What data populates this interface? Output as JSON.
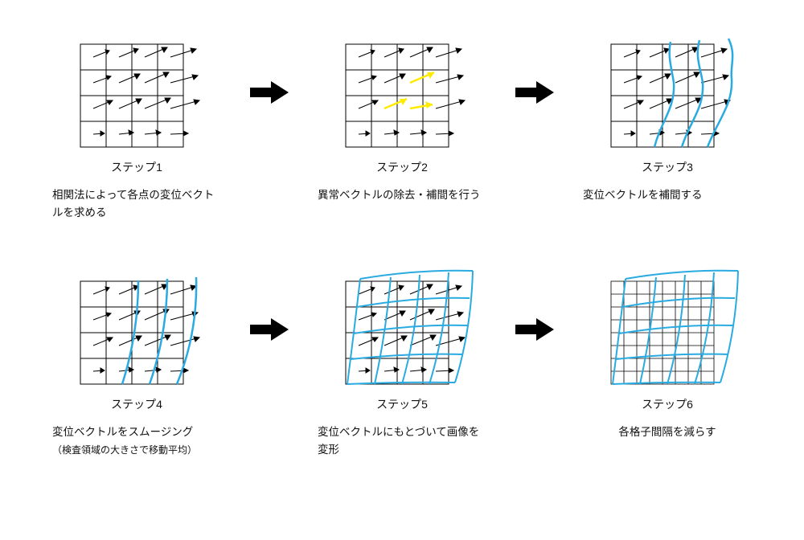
{
  "steps": [
    {
      "label": "ステップ1",
      "desc": "相関法によって各点の変位ベクトルを求める"
    },
    {
      "label": "ステップ2",
      "desc": "異常ベクトルの除去・補間を行う"
    },
    {
      "label": "ステップ3",
      "desc": "変位ベクトルを補間する"
    },
    {
      "label": "ステップ4",
      "desc": "変位ベクトルをスムージング",
      "desc_sub": "（検査領域の大きさで移動平均）"
    },
    {
      "label": "ステップ5",
      "desc": "変位ベクトルにもとづいて画像を変形"
    },
    {
      "label": "ステップ6",
      "desc": "各格子間隔を減らす"
    }
  ],
  "chart_data": {
    "type": "diagram",
    "title": "",
    "stages": [
      {
        "step": 1,
        "grid": 4,
        "vectors": "black",
        "note": "compute displacement vectors by correlation"
      },
      {
        "step": 2,
        "grid": 4,
        "vectors": "black",
        "outliers_highlight": "yellow",
        "note": "detect/remove outlier vectors and interpolate"
      },
      {
        "step": 3,
        "grid": 4,
        "vectors": "black",
        "interpolation_curves": "cyan",
        "curve_count": 3,
        "note": "interpolate displacement vectors (vertical curves)"
      },
      {
        "step": 4,
        "grid": 4,
        "vectors": "black",
        "smoothed_curves": "cyan",
        "curve_count": 3,
        "note": "smooth vectors (moving average over inspection region)"
      },
      {
        "step": 5,
        "grid": 4,
        "vectors": "black",
        "warped_grid_overlay": "cyan",
        "warped_grid_cells": 4,
        "note": "deform image according to displacement field"
      },
      {
        "step": 6,
        "grid_fine": 8,
        "vectors": "none",
        "warped_grid_overlay": "cyan",
        "warped_grid_cells": 4,
        "note": "reduce grid spacing (refine)"
      }
    ],
    "colors": {
      "grid": "#000000",
      "vector": "#000000",
      "highlight": "#ffeb00",
      "curve": "#29abe2"
    }
  }
}
